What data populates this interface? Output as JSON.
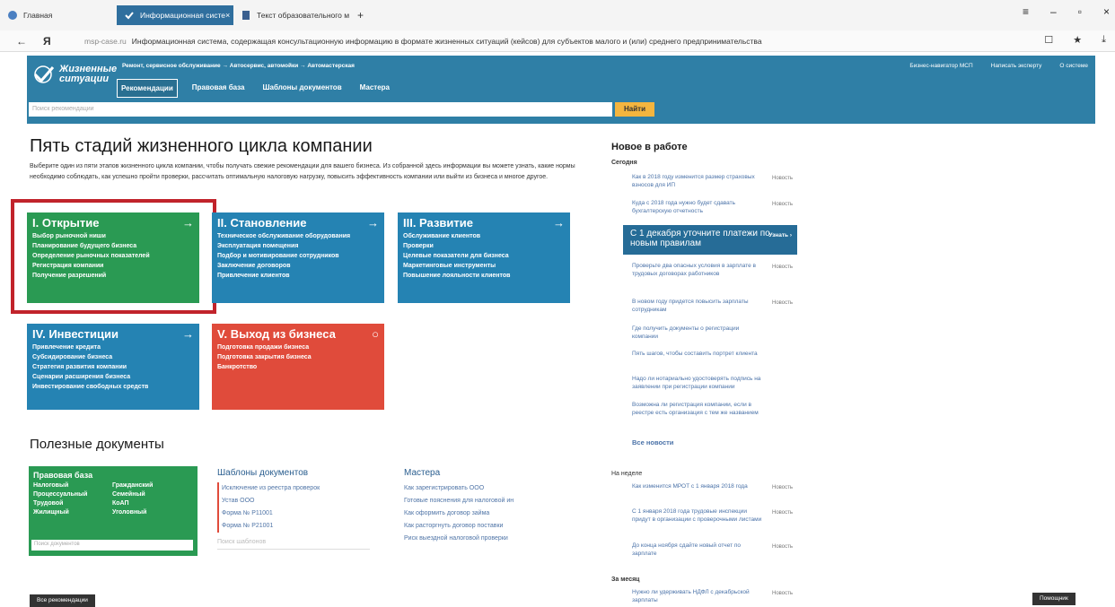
{
  "browser": {
    "tabs": [
      {
        "label": "Главная"
      },
      {
        "label": "Информационная систе"
      },
      {
        "label": "Текст образовательного м"
      }
    ],
    "new_tab": "+",
    "url_host": "msp-case.ru",
    "url_title": "Информационная система, содержащая консультационную информацию в формате жизненных ситуаций (кейсов) для субъектов малого и (или) среднего предпринимательства"
  },
  "site": {
    "logo_line1": "Жизненные",
    "logo_line2": "ситуации",
    "breadcrumb": "Ремонт, сервисное обслуживание → Автосервис, автомойки → Автомастерская",
    "nav": [
      "Рекомендации",
      "Правовая база",
      "Шаблоны документов",
      "Мастера"
    ],
    "top_links": [
      "Бизнес-навигатор МСП",
      "Написать эксперту",
      "О системе"
    ],
    "search_placeholder": "Поиск рекомендации",
    "search_button": "Найти"
  },
  "main": {
    "title": "Пять стадий жизненного цикла компании",
    "intro": "Выберите один из пяти этапов жизненного цикла компании, чтобы получать свежие рекомендации для вашего бизнеса. Из собранной здесь информации вы можете узнать, какие нормы необходимо соблюдать, как успешно пройти проверки, рассчитать оптимальную налоговую нагрузку, повысить эффективность компании или выйти из бизнеса и многое другое.",
    "stages": [
      {
        "title": "I. Открытие",
        "items": [
          "Выбор рыночной ниши",
          "Планирование будущего бизнеса",
          "Определение рыночных показателей",
          "Регистрация компании",
          "Получение разрешений"
        ]
      },
      {
        "title": "II. Становление",
        "items": [
          "Техническое обслуживание оборудования",
          "Эксплуатация помещения",
          "Подбор и мотивирование сотрудников",
          "Заключение договоров",
          "Привлечение клиентов"
        ]
      },
      {
        "title": "III. Развитие",
        "items": [
          "Обслуживание клиентов",
          "Проверки",
          "Целевые показатели для бизнеса",
          "Маркетинговые инструменты",
          "Повышение лояльности клиентов"
        ]
      },
      {
        "title": "IV. Инвестиции",
        "items": [
          "Привлечение кредита",
          "Субсидирование бизнеса",
          "Стратегия развития компании",
          "Сценарии расширения бизнеса",
          "Инвестирование свободных средств"
        ]
      },
      {
        "title": "V. Выход из бизнеса",
        "items": [
          "Подготовка продажи бизнеса",
          "Подготовка закрытия бизнеса",
          "Банкротство"
        ]
      }
    ],
    "arrow": "→",
    "useful_title": "Полезные документы",
    "law": {
      "title": "Правовая база",
      "items": [
        "Налоговый",
        "Гражданский",
        "Процессуальный",
        "Семейный",
        "Трудовой",
        "КоАП",
        "Жилищный",
        "Уголовный"
      ],
      "placeholder": "Поиск документов"
    },
    "templates": {
      "title": "Шаблоны документов",
      "items": [
        "Исключение из реестра проверок",
        "Устав ООО",
        "Форма № Р11001",
        "Форма № Р21001"
      ],
      "placeholder": "Поиск шаблонов"
    },
    "masters": {
      "title": "Мастера",
      "items": [
        "Как зарегистрировать ООО",
        "Готовые пояснения для налоговой ин",
        "Как оформить договор займа",
        "Как расторгнуть договор поставки",
        "Риск выездной налоговой проверки"
      ]
    },
    "all_recs": "Все рекомендации"
  },
  "news": {
    "title": "Новое в работе",
    "today": "Сегодня",
    "today_items": [
      {
        "text": "Как в 2018 году изменится размер страховых взносов для ИП",
        "tag": "Новость"
      },
      {
        "text": "Куда с 2018 года нужно будет сдавать бухгалтерскую отчетность",
        "tag": "Новость"
      }
    ],
    "promo_text": "С 1 декабря уточните платежи по новым правилам",
    "promo_link": "Узнать",
    "more_items": [
      {
        "text": "Проверьте два опасных условия в зарплате в трудовых договорах работников",
        "tag": "Новость"
      },
      {
        "text": "В новом году придется повысить зарплаты сотрудникам",
        "tag": "Новость"
      },
      {
        "text": "Где получить документы о регистрации компании",
        "tag": ""
      },
      {
        "text": "Пять шагов, чтобы составить портрет клиента",
        "tag": ""
      },
      {
        "text": "Надо ли нотариально удостоверять подпись на заявлении при регистрации компании",
        "tag": ""
      },
      {
        "text": "Возможна ли регистрация компании, если в реестре есть организация с тем же названием",
        "tag": ""
      }
    ],
    "all_news": "Все новости",
    "week": "На неделе",
    "week_items": [
      {
        "text": "Как изменится МРОТ с 1 января 2018 года",
        "tag": "Новость"
      },
      {
        "text": "С 1 января 2018 года трудовые инспекции придут в организации с проверочными листами",
        "tag": "Новость"
      },
      {
        "text": "До конца ноября сдайте новый отчет по зарплате",
        "tag": "Новость"
      }
    ],
    "month": "За месяц",
    "month_items": [
      {
        "text": "Нужно ли удерживать НДФЛ с декабрьской зарплаты",
        "tag": "Новость"
      }
    ],
    "help": "Помощник"
  }
}
